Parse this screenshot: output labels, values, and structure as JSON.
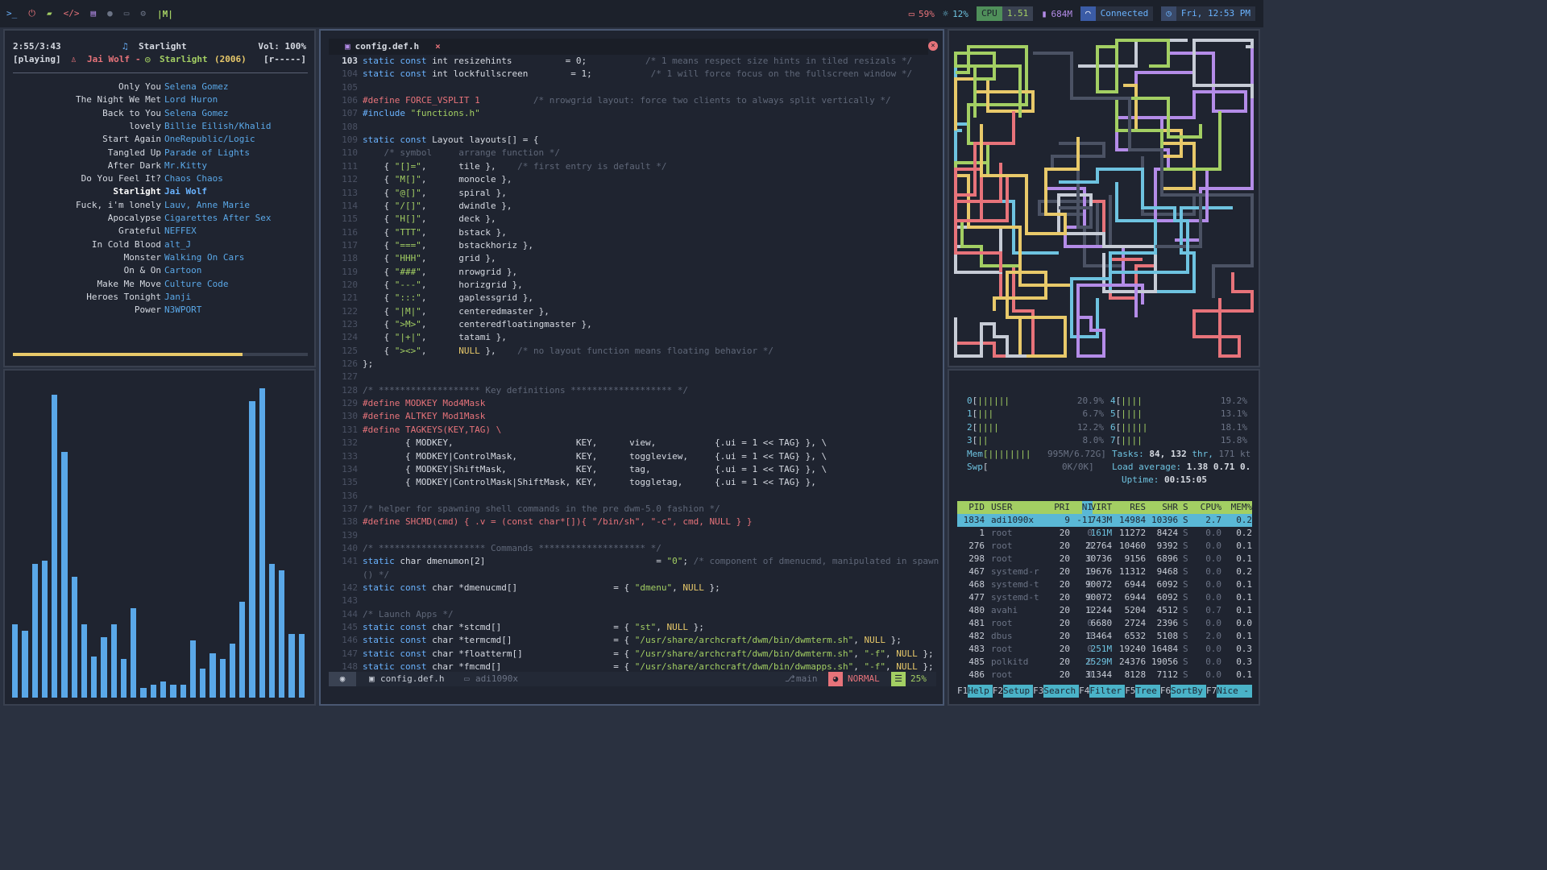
{
  "topbar": {
    "left_icons": [
      "terminal-icon",
      "power-icon",
      "folder-icon",
      "code-icon",
      "book-icon",
      "chat-icon",
      "mail-icon",
      "gear-icon"
    ],
    "layout_symbol": "|M|",
    "battery": "59%",
    "brightness": "12%",
    "cpu_label": "CPU",
    "cpu_value": "1.51",
    "memory": "684M",
    "network": "Connected",
    "datetime": "Fri, 12:53 PM",
    "colors": {
      "bar": "#1c212b",
      "cpu_label_bg": "#4f8f5a",
      "cpu_value_bg": "#3a4252",
      "network_bg": "#3b5ca6",
      "clock_bg": "#3a4a6a",
      "accent_green": "#a3cf63",
      "accent_blue": "#6ab3ff",
      "accent_purple": "#b48ce8",
      "accent_yellow": "#e8c96a"
    }
  },
  "music": {
    "elapsed": "2:55/3:43",
    "title_top": "Starlight",
    "volume": "Vol: 100%",
    "state": "[playing]",
    "artist": "Jai Wolf",
    "separator": "-",
    "album": "Starlight",
    "year": "(2006)",
    "mode": "[r-----]",
    "progress": 0.78,
    "playlist": [
      {
        "title": "Only You",
        "artist": "Selena Gomez"
      },
      {
        "title": "The Night We Met",
        "artist": "Lord Huron"
      },
      {
        "title": "Back to You",
        "artist": "Selena Gomez"
      },
      {
        "title": "lovely",
        "artist": "Billie Eilish/Khalid"
      },
      {
        "title": "Start Again",
        "artist": "OneRepublic/Logic"
      },
      {
        "title": "Tangled Up",
        "artist": "Parade of Lights"
      },
      {
        "title": "After Dark",
        "artist": "Mr.Kitty"
      },
      {
        "title": "Do You Feel It?",
        "artist": "Chaos Chaos"
      },
      {
        "title": "Starlight",
        "artist": "Jai Wolf",
        "current": true
      },
      {
        "title": "Fuck, i'm lonely",
        "artist": "Lauv, Anne Marie"
      },
      {
        "title": "Apocalypse",
        "artist": "Cigarettes After Sex"
      },
      {
        "title": "Grateful",
        "artist": "NEFFEX"
      },
      {
        "title": "In Cold Blood",
        "artist": "alt_J"
      },
      {
        "title": "Monster",
        "artist": "Walking On Cars"
      },
      {
        "title": "On & On",
        "artist": "Cartoon"
      },
      {
        "title": "Make Me Move",
        "artist": "Culture Code"
      },
      {
        "title": "Heroes Tonight",
        "artist": "Janji"
      },
      {
        "title": "Power",
        "artist": "N3WPORT"
      }
    ]
  },
  "visualizer": {
    "bar_color": "#5aa8e8",
    "levels": [
      0.23,
      0.21,
      0.42,
      0.43,
      0.95,
      0.77,
      0.38,
      0.23,
      0.13,
      0.19,
      0.23,
      0.12,
      0.28,
      0.03,
      0.04,
      0.05,
      0.04,
      0.04,
      0.18,
      0.09,
      0.14,
      0.12,
      0.17,
      0.3,
      0.93,
      0.97,
      0.42,
      0.4,
      0.2,
      0.2
    ]
  },
  "editor": {
    "tab_title": "config.def.h",
    "tab_close": "×",
    "lines": [
      {
        "n": "103",
        "t": "static const int resizehints          = 0;           /* 1 means respect size hints in tiled resizals */"
      },
      {
        "n": "104",
        "t": "static const int lockfullscreen        = 1;           /* 1 will force focus on the fullscreen window */"
      },
      {
        "n": "105",
        "t": ""
      },
      {
        "n": "106",
        "t": "#define FORCE_VSPLIT 1          /* nrowgrid layout: force two clients to always split vertically */"
      },
      {
        "n": "107",
        "t": "#include \"functions.h\""
      },
      {
        "n": "108",
        "t": ""
      },
      {
        "n": "109",
        "t": "static const Layout layouts[] = {"
      },
      {
        "n": "110",
        "t": "    /* symbol     arrange function */"
      },
      {
        "n": "111",
        "t": "    { \"[]=\",      tile },    /* first entry is default */"
      },
      {
        "n": "112",
        "t": "    { \"M[]\",      monocle },"
      },
      {
        "n": "113",
        "t": "    { \"@[]\",      spiral },"
      },
      {
        "n": "114",
        "t": "    { \"/[]\",      dwindle },"
      },
      {
        "n": "115",
        "t": "    { \"H[]\",      deck },"
      },
      {
        "n": "116",
        "t": "    { \"TTT\",      bstack },"
      },
      {
        "n": "117",
        "t": "    { \"===\",      bstackhoriz },"
      },
      {
        "n": "118",
        "t": "    { \"HHH\",      grid },"
      },
      {
        "n": "119",
        "t": "    { \"###\",      nrowgrid },"
      },
      {
        "n": "120",
        "t": "    { \"---\",      horizgrid },"
      },
      {
        "n": "121",
        "t": "    { \":::\",      gaplessgrid },"
      },
      {
        "n": "122",
        "t": "    { \"|M|\",      centeredmaster },"
      },
      {
        "n": "123",
        "t": "    { \">M>\",      centeredfloatingmaster },"
      },
      {
        "n": "124",
        "t": "    { \"|+|\",      tatami },"
      },
      {
        "n": "125",
        "t": "    { \"><>\",      NULL },    /* no layout function means floating behavior */"
      },
      {
        "n": "126",
        "t": "};"
      },
      {
        "n": "127",
        "t": ""
      },
      {
        "n": "128",
        "t": "/* ******************* Key definitions ******************* */"
      },
      {
        "n": "129",
        "t": "#define MODKEY Mod4Mask"
      },
      {
        "n": "130",
        "t": "#define ALTKEY Mod1Mask"
      },
      {
        "n": "131",
        "t": "#define TAGKEYS(KEY,TAG) \\"
      },
      {
        "n": "132",
        "t": "        { MODKEY,                       KEY,      view,           {.ui = 1 << TAG} }, \\"
      },
      {
        "n": "133",
        "t": "        { MODKEY|ControlMask,           KEY,      toggleview,     {.ui = 1 << TAG} }, \\"
      },
      {
        "n": "134",
        "t": "        { MODKEY|ShiftMask,             KEY,      tag,            {.ui = 1 << TAG} }, \\"
      },
      {
        "n": "135",
        "t": "        { MODKEY|ControlMask|ShiftMask, KEY,      toggletag,      {.ui = 1 << TAG} },"
      },
      {
        "n": "136",
        "t": ""
      },
      {
        "n": "137",
        "t": "/* helper for spawning shell commands in the pre dwm-5.0 fashion */"
      },
      {
        "n": "138",
        "t": "#define SHCMD(cmd) { .v = (const char*[]){ \"/bin/sh\", \"-c\", cmd, NULL } }"
      },
      {
        "n": "139",
        "t": ""
      },
      {
        "n": "140",
        "t": "/* ******************** Commands ******************** */"
      },
      {
        "n": "141",
        "t": "static char dmenumon[2]                                = \"0\"; /* component of dmenucmd, manipulated in spawn"
      },
      {
        "n": "",
        "t": "() */"
      },
      {
        "n": "142",
        "t": "static const char *dmenucmd[]                  = { \"dmenu\", NULL };"
      },
      {
        "n": "143",
        "t": ""
      },
      {
        "n": "144",
        "t": "/* Launch Apps */"
      },
      {
        "n": "145",
        "t": "static const char *stcmd[]                     = { \"st\", NULL };"
      },
      {
        "n": "146",
        "t": "static const char *termcmd[]                   = { \"/usr/share/archcraft/dwm/bin/dwmterm.sh\", NULL };"
      },
      {
        "n": "147",
        "t": "static const char *floatterm[]                 = { \"/usr/share/archcraft/dwm/bin/dwmterm.sh\", \"-f\", NULL };"
      },
      {
        "n": "148",
        "t": "static const char *fmcmd[]                     = { \"/usr/share/archcraft/dwm/bin/dwmapps.sh\", \"-f\", NULL };"
      }
    ],
    "status": {
      "file": "config.def.h",
      "user": "adi1090x",
      "branch": "main",
      "mode": "NORMAL",
      "percent": "25%"
    }
  },
  "htop": {
    "cpus": [
      {
        "id": "0",
        "bars": "||||||",
        "pct": "20.9%"
      },
      {
        "id": "1",
        "bars": "|||",
        "pct": "6.7%"
      },
      {
        "id": "2",
        "bars": "||||",
        "pct": "12.2%"
      },
      {
        "id": "3",
        "bars": "||",
        "pct": "8.0%"
      },
      {
        "id": "4",
        "bars": "||||",
        "pct": "19.2%"
      },
      {
        "id": "5",
        "bars": "||||",
        "pct": "13.1%"
      },
      {
        "id": "6",
        "bars": "|||||",
        "pct": "18.1%"
      },
      {
        "id": "7",
        "bars": "||||",
        "pct": "15.8%"
      }
    ],
    "mem_label": "Mem",
    "mem_bars": "[||||||||",
    "mem_value": "995M/6.72G]",
    "swp_label": "Swp",
    "swp_value": "0K/0K]",
    "tasks_label": "Tasks:",
    "tasks_count": "84,",
    "threads": "132",
    "threads_suffix": "thr,",
    "kthreads": "171 kt",
    "load_label": "Load average:",
    "load": "1.38 0.71 0.",
    "uptime_label": "Uptime:",
    "uptime": "00:15:05",
    "headers": [
      "PID",
      "USER",
      "PRI",
      "NI",
      "VIRT",
      "RES",
      "SHR",
      "S",
      "CPU%",
      "MEM%"
    ],
    "rows": [
      {
        "pid": "1834",
        "user": "adi1090x",
        "pri": "9",
        "ni": "-11",
        "virt": "743M",
        "res": "14984",
        "shr": "10396",
        "s": "S",
        "cpu": "2.7",
        "mem": "0.2",
        "selected": true
      },
      {
        "pid": "1",
        "user": "root",
        "pri": "20",
        "ni": "0",
        "virt": "161M",
        "res": "11272",
        "shr": "8424",
        "s": "S",
        "cpu": "0.0",
        "mem": "0.2"
      },
      {
        "pid": "276",
        "user": "root",
        "pri": "20",
        "ni": "0",
        "virt": "22764",
        "res": "10460",
        "shr": "9392",
        "s": "S",
        "cpu": "0.0",
        "mem": "0.1"
      },
      {
        "pid": "298",
        "user": "root",
        "pri": "20",
        "ni": "0",
        "virt": "30736",
        "res": "9156",
        "shr": "6896",
        "s": "S",
        "cpu": "0.0",
        "mem": "0.1"
      },
      {
        "pid": "467",
        "user": "systemd-r",
        "pri": "20",
        "ni": "0",
        "virt": "19676",
        "res": "11312",
        "shr": "9468",
        "s": "S",
        "cpu": "0.0",
        "mem": "0.2"
      },
      {
        "pid": "468",
        "user": "systemd-t",
        "pri": "20",
        "ni": "0",
        "virt": "90072",
        "res": "6944",
        "shr": "6092",
        "s": "S",
        "cpu": "0.0",
        "mem": "0.1"
      },
      {
        "pid": "477",
        "user": "systemd-t",
        "pri": "20",
        "ni": "0",
        "virt": "90072",
        "res": "6944",
        "shr": "6092",
        "s": "S",
        "cpu": "0.0",
        "mem": "0.1"
      },
      {
        "pid": "480",
        "user": "avahi",
        "pri": "20",
        "ni": "0",
        "virt": "12244",
        "res": "5204",
        "shr": "4512",
        "s": "S",
        "cpu": "0.7",
        "mem": "0.1"
      },
      {
        "pid": "481",
        "user": "root",
        "pri": "20",
        "ni": "0",
        "virt": "6680",
        "res": "2724",
        "shr": "2396",
        "s": "S",
        "cpu": "0.0",
        "mem": "0.0"
      },
      {
        "pid": "482",
        "user": "dbus",
        "pri": "20",
        "ni": "0",
        "virt": "13464",
        "res": "6532",
        "shr": "5108",
        "s": "S",
        "cpu": "2.0",
        "mem": "0.1"
      },
      {
        "pid": "483",
        "user": "root",
        "pri": "20",
        "ni": "0",
        "virt": "251M",
        "res": "19240",
        "shr": "16484",
        "s": "S",
        "cpu": "0.0",
        "mem": "0.3"
      },
      {
        "pid": "485",
        "user": "polkitd",
        "pri": "20",
        "ni": "0",
        "virt": "2529M",
        "res": "24376",
        "shr": "19056",
        "s": "S",
        "cpu": "0.0",
        "mem": "0.3"
      },
      {
        "pid": "486",
        "user": "root",
        "pri": "20",
        "ni": "0",
        "virt": "31344",
        "res": "8128",
        "shr": "7112",
        "s": "S",
        "cpu": "0.0",
        "mem": "0.1"
      }
    ],
    "fkeys": [
      {
        "k": "F1",
        "l": "Help"
      },
      {
        "k": "F2",
        "l": "Setup"
      },
      {
        "k": "F3",
        "l": "Search"
      },
      {
        "k": "F4",
        "l": "Filter"
      },
      {
        "k": "F5",
        "l": "Tree"
      },
      {
        "k": "F6",
        "l": "SortBy"
      },
      {
        "k": "F7",
        "l": "Nice -"
      }
    ],
    "colors": {
      "header_bg": "#a3cf63",
      "selected_bg": "#5ab8d6",
      "fkey_bg": "#4ab3c8"
    }
  },
  "pipes": {
    "colors": [
      "#e7737a",
      "#b48ce8",
      "#6ec3e0",
      "#e8c96a",
      "#a3cf63",
      "#c7ccd6",
      "#4b5264"
    ]
  }
}
